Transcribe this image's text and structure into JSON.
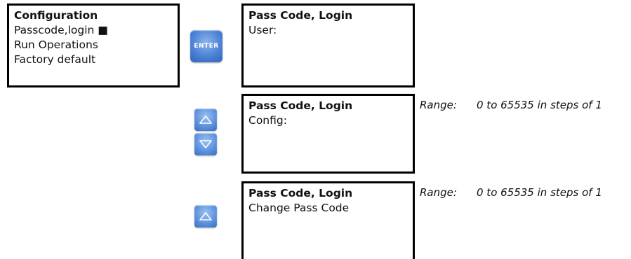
{
  "config_screen": {
    "title": "Configuration",
    "items": [
      "Passcode,login ■",
      "Run Operations",
      "Factory default"
    ]
  },
  "enter_button": {
    "label": "ENTER",
    "icon": "enter-key"
  },
  "screen_user": {
    "title": "Pass Code, Login",
    "line": "User:"
  },
  "screen_config": {
    "title": "Pass Code, Login",
    "line": "Config:"
  },
  "screen_change": {
    "title": "Pass Code, Login",
    "line": "Change Pass Code"
  },
  "arrow_buttons": {
    "up_icon": "up-arrow-icon",
    "down_icon": "down-arrow-icon"
  },
  "range_config": {
    "label": "Range:",
    "value": "0 to 65535 in steps of 1"
  },
  "range_change": {
    "label": "Range:",
    "value": "0 to 65535 in steps of 1"
  }
}
